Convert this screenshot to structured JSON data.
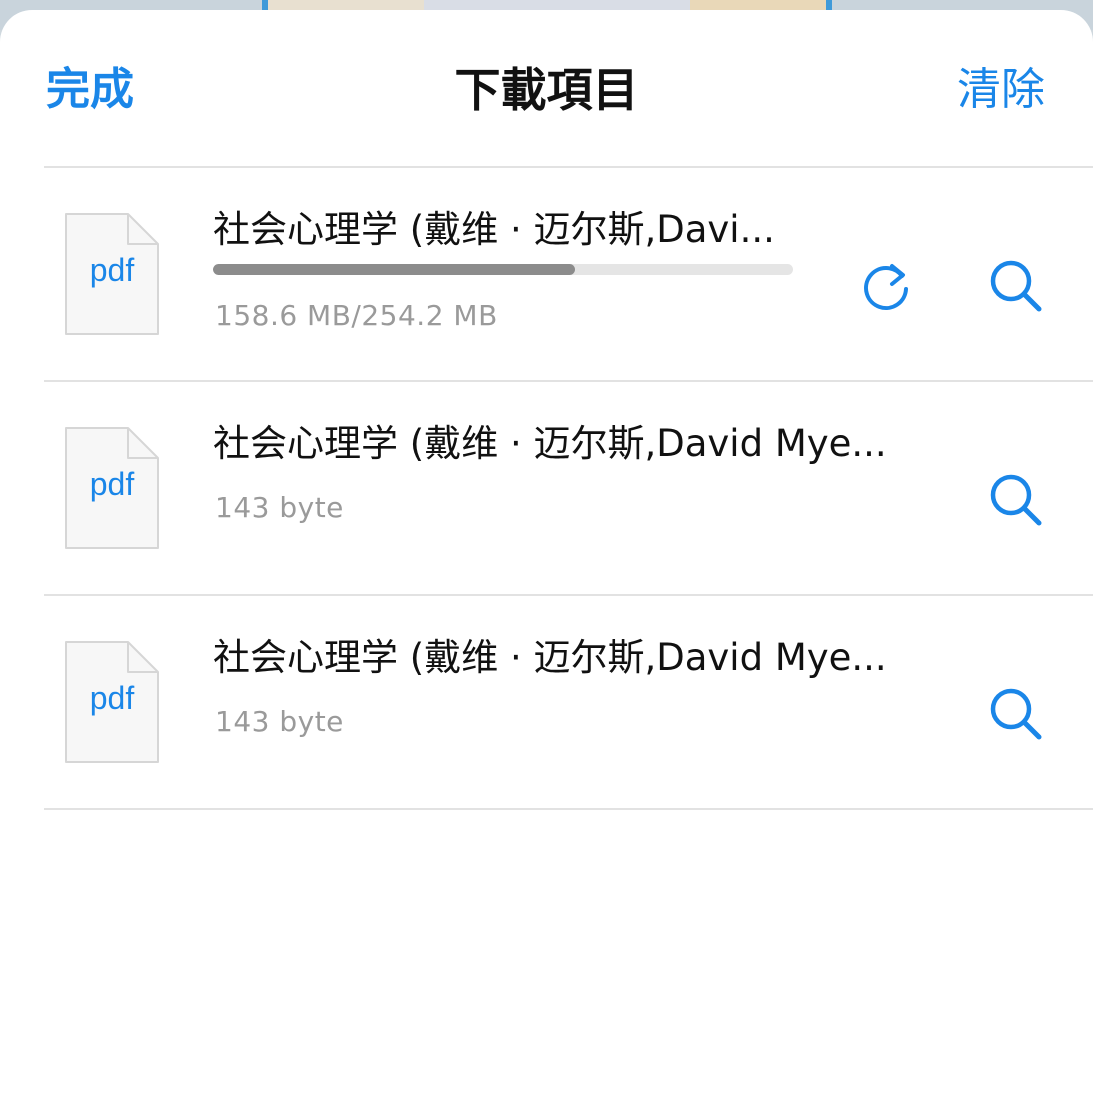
{
  "nav": {
    "done_label": "完成",
    "title": "下載項目",
    "clear_label": "清除"
  },
  "colors": {
    "accent": "#1a86e8",
    "progress": "#8c8c8c"
  },
  "downloads": [
    {
      "file_type": "pdf",
      "name": "社会心理学 (戴维 · 迈尔斯,Davi...",
      "size": "158.6 MB/254.2 MB",
      "in_progress": true,
      "progress_fraction": 0.624,
      "actions": [
        "retry-icon",
        "search-icon"
      ]
    },
    {
      "file_type": "pdf",
      "name": "社会心理学 (戴维 · 迈尔斯,David Mye...",
      "size": "143 byte",
      "in_progress": false,
      "actions": [
        "search-icon"
      ]
    },
    {
      "file_type": "pdf",
      "name": "社会心理学 (戴维 · 迈尔斯,David Mye...",
      "size": "143 byte",
      "in_progress": false,
      "actions": [
        "search-icon"
      ]
    }
  ]
}
